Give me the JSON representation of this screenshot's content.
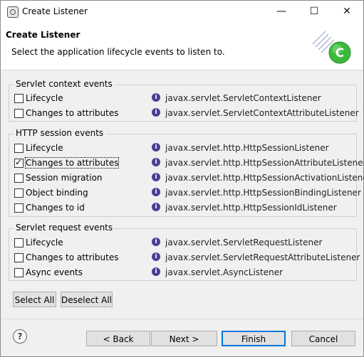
{
  "window": {
    "title": "Create Listener",
    "minimize_glyph": "—",
    "maximize_glyph": "☐",
    "close_glyph": "✕"
  },
  "header": {
    "title": "Create Listener",
    "description": "Select the application lifecycle events to listen to."
  },
  "groups": [
    {
      "title": "Servlet context events",
      "items": [
        {
          "label": "Lifecycle",
          "checked": false,
          "class": "javax.servlet.ServletContextListener"
        },
        {
          "label": "Changes to attributes",
          "checked": false,
          "class": "javax.servlet.ServletContextAttributeListener"
        }
      ]
    },
    {
      "title": "HTTP session events",
      "items": [
        {
          "label": "Lifecycle",
          "checked": false,
          "class": "javax.servlet.http.HttpSessionListener"
        },
        {
          "label": "Changes to attributes",
          "checked": true,
          "class": "javax.servlet.http.HttpSessionAttributeListener"
        },
        {
          "label": "Session migration",
          "checked": false,
          "class": "javax.servlet.http.HttpSessionActivationListener"
        },
        {
          "label": "Object binding",
          "checked": false,
          "class": "javax.servlet.http.HttpSessionBindingListener"
        },
        {
          "label": "Changes to id",
          "checked": false,
          "class": "javax.servlet.http.HttpSessionIdListener"
        }
      ]
    },
    {
      "title": "Servlet request events",
      "items": [
        {
          "label": "Lifecycle",
          "checked": false,
          "class": "javax.servlet.ServletRequestListener"
        },
        {
          "label": "Changes to attributes",
          "checked": false,
          "class": "javax.servlet.ServletRequestAttributeListener"
        },
        {
          "label": "Async events",
          "checked": false,
          "class": "javax.servlet.AsyncListener"
        }
      ]
    }
  ],
  "info_icon_glyph": "i",
  "select_all": "Select All",
  "deselect_all": "Deselect All",
  "help_glyph": "?",
  "footer": {
    "back": "< Back",
    "next": "Next >",
    "finish": "Finish",
    "cancel": "Cancel"
  },
  "colors": {
    "info_icon": "#4e3b94",
    "default_button_border": "#0078d7",
    "banner_green": "#3cb93c"
  }
}
